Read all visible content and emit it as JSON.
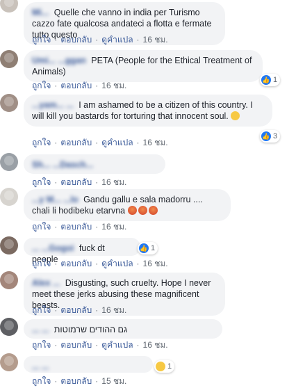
{
  "actions": {
    "like": "ถูกใจ",
    "reply": "ตอบกลับ",
    "translate": "ดูคำแปล",
    "sep": "·"
  },
  "comments": [
    {
      "name": "Mi...",
      "text": "Quelle che vanno in india per Turismo cazzo fate qualcosa andateci a flotta e fermate tutto questo",
      "time": "16 ชม.",
      "reaction_count": ""
    },
    {
      "name": "Umi... ...ggan",
      "text": "PETA (People for the Ethical Treatment of Animals)",
      "time": "16 ชม.",
      "reaction_count": "1"
    },
    {
      "name": "...yam... ...",
      "text": "I am ashamed to be a citizen of this country. I will kill you bastards for torturing that innocent soul.",
      "time": "16 ชม.",
      "reaction_count": "3"
    },
    {
      "name": "Sh... ...Dasch...",
      "text": "",
      "time": "16 ชม.",
      "reaction_count": ""
    },
    {
      "name": "...y M... ...lo",
      "text": "Gandu gallu e sala madorru .... chali li hodibeku etarvna",
      "time": "16 ชม.",
      "reaction_count": ""
    },
    {
      "name": "... ...Gogoi",
      "text": "fuck dt people",
      "time": "16 ชม.",
      "reaction_count": "1"
    },
    {
      "name": "Alex ...",
      "text": "Disgusting, such cruelty. Hope I never meet these jerks abusing these magnificent beasts.",
      "time": "16 ชม.",
      "reaction_count": ""
    },
    {
      "name": "... ...",
      "text": "גם ההודים שרמוטות",
      "time": "16 ชม.",
      "reaction_count": ""
    },
    {
      "name": "... ...",
      "text": "",
      "time": "15 ชม.",
      "reaction_count": "1"
    }
  ]
}
